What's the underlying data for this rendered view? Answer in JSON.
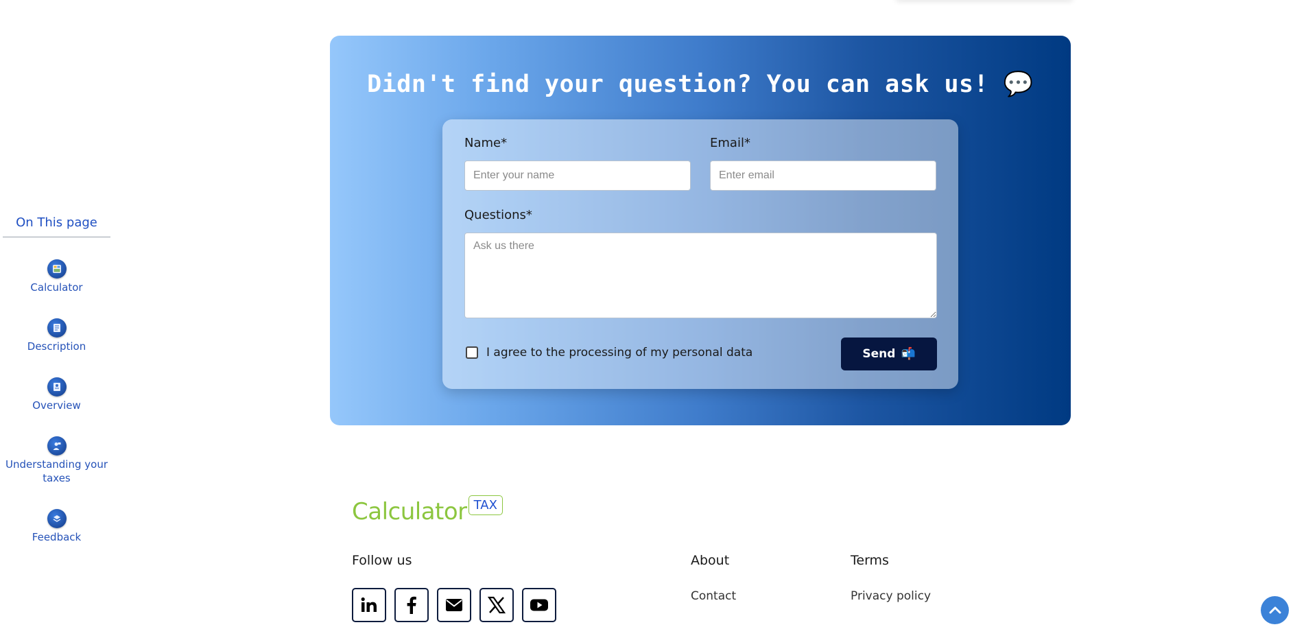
{
  "sidebar": {
    "title": "On This page",
    "items": [
      {
        "label": "Calculator",
        "icon": "calculator-icon"
      },
      {
        "label": "Description",
        "icon": "document-icon"
      },
      {
        "label": "Overview",
        "icon": "overview-icon"
      },
      {
        "label": "Understanding your taxes",
        "icon": "person-icon"
      },
      {
        "label": "Feedback",
        "icon": "feedback-icon"
      }
    ]
  },
  "contact": {
    "title": "Didn't find your question? You can ask us! 💬",
    "name_label": "Name*",
    "name_placeholder": "Enter your name",
    "email_label": "Email*",
    "email_placeholder": "Enter email",
    "questions_label": "Questions*",
    "questions_placeholder": "Ask us there",
    "consent_text": "I agree to the processing of my personal data",
    "send_label": "Send",
    "send_emoji": "📬"
  },
  "footer": {
    "logo_main": "Calculator",
    "logo_badge": "TAX",
    "follow_heading": "Follow us",
    "about_heading": "About",
    "about_link": "Contact",
    "terms_heading": "Terms",
    "terms_link": "Privacy policy",
    "socials": [
      "linkedin-icon",
      "facebook-icon",
      "email-icon",
      "x-icon",
      "youtube-icon"
    ]
  },
  "colors": {
    "accent_blue": "#1f4fc2",
    "logo_green": "#8cc63f",
    "send_button": "#061640",
    "panel_start": "#95c7fb",
    "panel_end": "#003a82"
  }
}
